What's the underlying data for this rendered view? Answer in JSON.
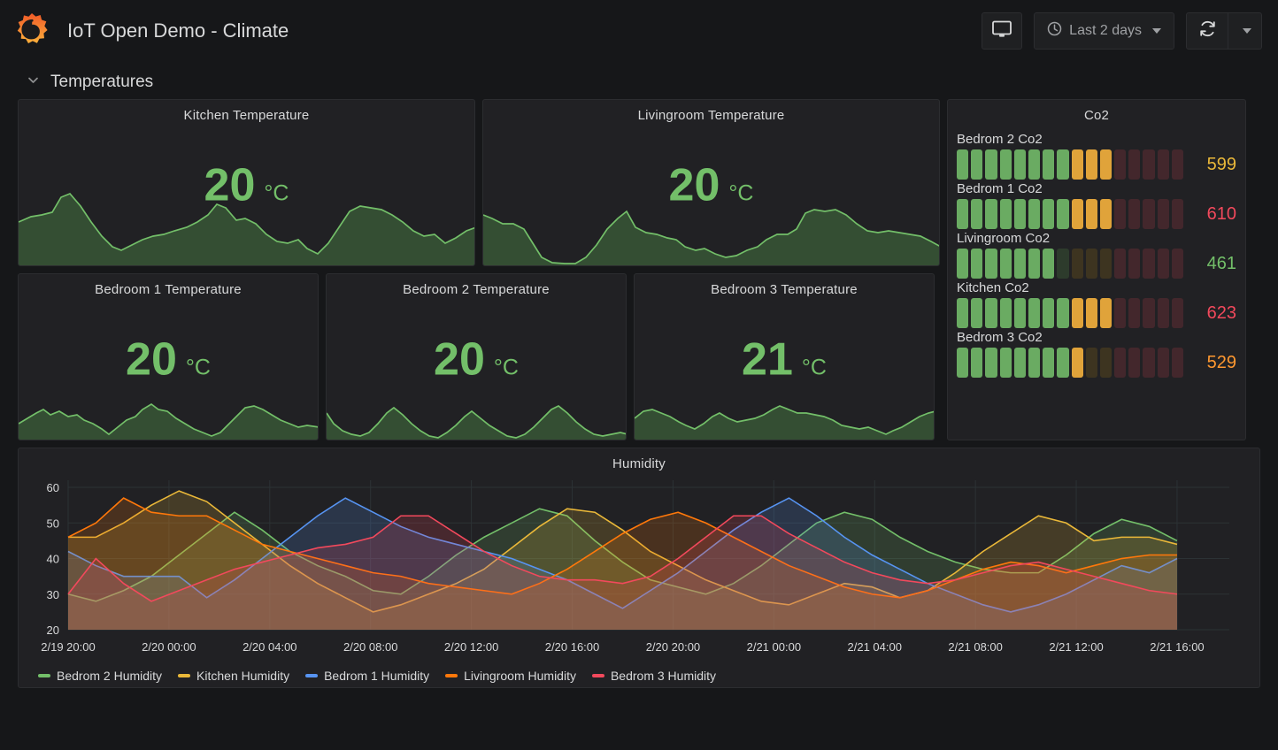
{
  "header": {
    "title": "IoT Open Demo - Climate",
    "logo_icon": "grafana-logo-icon",
    "kiosk_icon": "tv-monitor-icon",
    "clock_icon": "clock-icon",
    "time_range": "Last 2 days",
    "refresh_icon": "refresh-icon",
    "refresh_caret_icon": "chevron-down-icon"
  },
  "row": {
    "chevron_icon": "chevron-down-icon",
    "title": "Temperatures"
  },
  "temperature_panels": [
    {
      "title": "Kitchen Temperature",
      "value": "20",
      "unit": "°C"
    },
    {
      "title": "Livingroom Temperature",
      "value": "20",
      "unit": "°C"
    },
    {
      "title": "Bedroom 1 Temperature",
      "value": "20",
      "unit": "°C"
    },
    {
      "title": "Bedroom 2 Temperature",
      "value": "20",
      "unit": "°C"
    },
    {
      "title": "Bedroom 3 Temperature",
      "value": "21",
      "unit": "°C"
    }
  ],
  "co2_panel": {
    "title": "Co2",
    "rows": [
      {
        "label": "Bedrom 2 Co2",
        "value": "599",
        "value_color": "#eab839",
        "green": 8,
        "yellow": 3,
        "dim_green": 0,
        "dim_yellow": 0
      },
      {
        "label": "Bedrom 1 Co2",
        "value": "610",
        "value_color": "#f2495c",
        "green": 8,
        "yellow": 3,
        "dim_green": 0,
        "dim_yellow": 0
      },
      {
        "label": "Livingroom Co2",
        "value": "461",
        "value_color": "#73bf69",
        "green": 7,
        "yellow": 0,
        "dim_green": 1,
        "dim_yellow": 3
      },
      {
        "label": "Kitchen Co2",
        "value": "623",
        "value_color": "#f2495c",
        "green": 8,
        "yellow": 3,
        "dim_green": 0,
        "dim_yellow": 0
      },
      {
        "label": "Bedrom 3 Co2",
        "value": "529",
        "value_color": "#ff9830",
        "green": 8,
        "yellow": 1,
        "dim_green": 0,
        "dim_yellow": 2
      }
    ],
    "segments_total": 16,
    "colors": {
      "green": "#6aab62",
      "yellow": "#e0a33a",
      "dim_green": "#2d3b2c",
      "dim_yellow": "#3d3420",
      "dim_red": "#43272c"
    }
  },
  "chart_data": {
    "type": "line",
    "title": "Humidity",
    "xlabel": "",
    "ylabel": "",
    "ylim": [
      20,
      62
    ],
    "yticks": [
      20,
      30,
      40,
      50,
      60
    ],
    "grid": true,
    "legend_position": "bottom",
    "x": [
      "2/19 20:00",
      "2/20 00:00",
      "2/20 04:00",
      "2/20 08:00",
      "2/20 12:00",
      "2/20 16:00",
      "2/20 20:00",
      "2/21 00:00",
      "2/21 04:00",
      "2/21 08:00",
      "2/21 12:00",
      "2/21 16:00"
    ],
    "xticks": [
      "2/19 20:00",
      "2/20 00:00",
      "2/20 04:00",
      "2/20 08:00",
      "2/20 12:00",
      "2/20 16:00",
      "2/20 20:00",
      "2/21 00:00",
      "2/21 04:00",
      "2/21 08:00",
      "2/21 12:00",
      "2/21 16:00"
    ],
    "series": [
      {
        "name": "Bedrom 2 Humidity",
        "color": "#73bf69",
        "values": [
          30,
          28,
          31,
          35,
          41,
          47,
          53,
          48,
          42,
          38,
          35,
          31,
          30,
          35,
          41,
          46,
          50,
          54,
          52,
          45,
          39,
          34,
          32,
          30,
          33,
          38,
          44,
          50,
          53,
          51,
          46,
          42,
          39,
          37,
          36,
          36,
          41,
          47,
          51,
          49,
          45
        ]
      },
      {
        "name": "Kitchen Humidity",
        "color": "#eab839",
        "values": [
          46,
          46,
          50,
          55,
          59,
          56,
          50,
          44,
          38,
          33,
          29,
          25,
          27,
          30,
          33,
          37,
          43,
          49,
          54,
          53,
          48,
          42,
          38,
          34,
          31,
          28,
          27,
          30,
          33,
          32,
          29,
          31,
          36,
          42,
          47,
          52,
          50,
          45,
          46,
          46,
          44
        ]
      },
      {
        "name": "Bedrom 1 Humidity",
        "color": "#5794f2",
        "values": [
          42,
          38,
          35,
          35,
          35,
          29,
          34,
          40,
          46,
          52,
          57,
          53,
          49,
          46,
          44,
          42,
          40,
          37,
          34,
          30,
          26,
          31,
          36,
          42,
          48,
          53,
          57,
          52,
          46,
          41,
          37,
          33,
          30,
          27,
          25,
          27,
          30,
          34,
          38,
          36,
          40
        ]
      },
      {
        "name": "Livingroom Humidity",
        "color": "#ff780a",
        "values": [
          46,
          50,
          57,
          53,
          52,
          52,
          48,
          44,
          42,
          40,
          38,
          36,
          35,
          33,
          32,
          31,
          30,
          33,
          37,
          42,
          47,
          51,
          53,
          50,
          46,
          42,
          38,
          35,
          32,
          30,
          29,
          31,
          34,
          37,
          39,
          38,
          36,
          38,
          40,
          41,
          41
        ]
      },
      {
        "name": "Bedrom 3 Humidity",
        "color": "#f2495c",
        "values": [
          30,
          40,
          33,
          28,
          31,
          34,
          37,
          39,
          41,
          43,
          44,
          46,
          52,
          52,
          47,
          42,
          38,
          35,
          34,
          34,
          33,
          35,
          40,
          46,
          52,
          52,
          47,
          43,
          39,
          36,
          34,
          33,
          34,
          36,
          38,
          39,
          37,
          35,
          33,
          31,
          30
        ]
      }
    ]
  }
}
